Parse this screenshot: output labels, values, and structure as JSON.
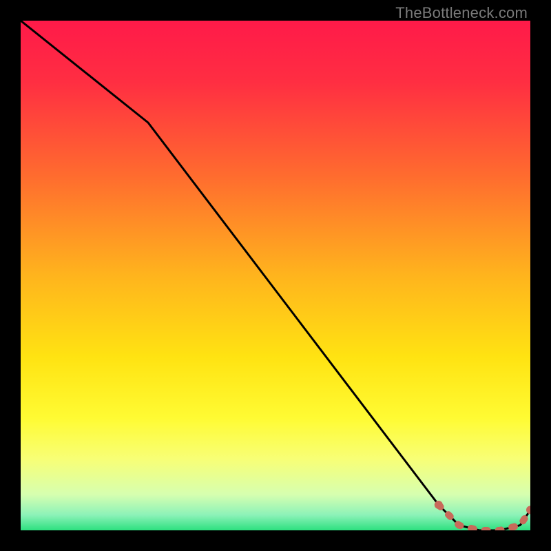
{
  "watermark": "TheBottleneck.com",
  "chart_data": {
    "type": "line",
    "title": "",
    "xlabel": "",
    "ylabel": "",
    "xlim": [
      0,
      100
    ],
    "ylim": [
      0,
      100
    ],
    "series": [
      {
        "name": "curve",
        "x": [
          0,
          25,
          82,
          86,
          90,
          94,
          98,
          100
        ],
        "values": [
          100,
          80,
          5,
          1,
          0,
          0,
          1,
          4
        ]
      }
    ],
    "dotted_segment": {
      "x": [
        82,
        86,
        90,
        94,
        98,
        100
      ],
      "values": [
        5,
        1,
        0,
        0,
        1,
        4
      ]
    },
    "background_gradient": {
      "stops": [
        {
          "offset": 0.0,
          "color": "#ff1a49"
        },
        {
          "offset": 0.12,
          "color": "#ff2e42"
        },
        {
          "offset": 0.3,
          "color": "#ff6a2f"
        },
        {
          "offset": 0.5,
          "color": "#ffb41d"
        },
        {
          "offset": 0.66,
          "color": "#ffe312"
        },
        {
          "offset": 0.78,
          "color": "#fffb33"
        },
        {
          "offset": 0.86,
          "color": "#f8ff76"
        },
        {
          "offset": 0.93,
          "color": "#d6ffb0"
        },
        {
          "offset": 0.97,
          "color": "#8cf2b8"
        },
        {
          "offset": 1.0,
          "color": "#2de07f"
        }
      ]
    },
    "colors": {
      "line": "#000000",
      "dots": "#c86a5a"
    }
  }
}
